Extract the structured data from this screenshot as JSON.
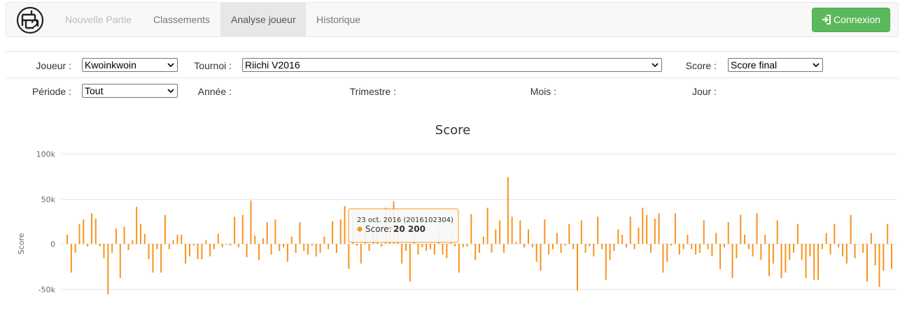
{
  "nav": {
    "items": [
      {
        "label": "Nouvelle Partie",
        "state": "disabled"
      },
      {
        "label": "Classements",
        "state": "normal"
      },
      {
        "label": "Analyse joueur",
        "state": "active"
      },
      {
        "label": "Historique",
        "state": "normal"
      }
    ],
    "login_label": "Connexion",
    "login_icon": "sign-in-icon",
    "brand_icon": "logo-icon"
  },
  "filters": {
    "joueur_label": "Joueur :",
    "joueur_value": "Kwoinkwoin",
    "tournoi_label": "Tournoi :",
    "tournoi_value": "Riichi V2016",
    "score_label": "Score :",
    "score_value": "Score final",
    "periode_label": "Période :",
    "periode_value": "Tout",
    "annee_label": "Année :",
    "trimestre_label": "Trimestre :",
    "mois_label": "Mois :",
    "jour_label": "Jour :"
  },
  "colors": {
    "bar": "#f7941d",
    "login": "#5cb85c",
    "grid": "#e6e6e6"
  },
  "chart_data": {
    "type": "bar",
    "title": "Score",
    "ylabel": "Score",
    "ylim": [
      -60000,
      100000
    ],
    "y_ticks": [
      {
        "value": 100000,
        "label": "100k"
      },
      {
        "value": 50000,
        "label": "50k"
      },
      {
        "value": 0,
        "label": "0"
      },
      {
        "value": -50000,
        "label": "-50k"
      }
    ],
    "grid": true,
    "series": [
      {
        "values": [
          10000,
          -32000,
          -10000,
          22000,
          27000,
          -3000,
          34000,
          28000,
          -3000,
          -16000,
          -56000,
          -10000,
          17000,
          -38000,
          19000,
          -7000,
          4000,
          41000,
          22000,
          11000,
          -17000,
          -32000,
          -6000,
          -32000,
          32000,
          -6000,
          4000,
          10000,
          10000,
          -22000,
          -14000,
          -2000,
          -17000,
          -17000,
          4000,
          -14000,
          -6000,
          11000,
          -4000,
          -1000,
          -2000,
          30000,
          -4000,
          32000,
          -15000,
          48000,
          9000,
          -18000,
          6000,
          24000,
          -12000,
          27000,
          -8000,
          -4000,
          -20000,
          8000,
          -10000,
          24000,
          -8000,
          -12000,
          -2000,
          -14000,
          -10000,
          8000,
          -6000,
          25000,
          -10000,
          27000,
          42000,
          -28000,
          34000,
          -2000,
          -22000,
          26000,
          -8000,
          23000,
          31000,
          -3000,
          40000,
          38000,
          47000,
          28000,
          -22000,
          -8000,
          -42000,
          26000,
          -12000,
          -4000,
          -8000,
          -6000,
          -12000,
          18000,
          -12000,
          -16000,
          10000,
          -3000,
          -32000,
          -4000,
          -3000,
          33000,
          -18000,
          -10000,
          8000,
          40000,
          -10000,
          16000,
          26000,
          -10000,
          74000,
          30000,
          2000,
          26000,
          -4000,
          16000,
          -4000,
          -20000,
          -30000,
          27000,
          -12000,
          -6000,
          12000,
          -10000,
          -2000,
          22000,
          -6000,
          -52000,
          26000,
          -10000,
          -3000,
          -14000,
          30000,
          -6000,
          -40000,
          -18000,
          -8000,
          16000,
          10000,
          -4000,
          30000,
          -6000,
          18000,
          40000,
          32000,
          -10000,
          28000,
          34000,
          -32000,
          -20000,
          -2000,
          34000,
          -12000,
          -6000,
          10000,
          -6000,
          -12000,
          -10000,
          26000,
          -6000,
          -14000,
          12000,
          -28000,
          -4000,
          24000,
          -38000,
          -16000,
          32000,
          10000,
          -6000,
          -14000,
          34000,
          -18000,
          10000,
          -36000,
          -22000,
          26000,
          -38000,
          -32000,
          -18000,
          -10000,
          22000,
          -18000,
          -38000,
          -14000,
          -40000,
          -40000,
          -6000,
          12000,
          -12000,
          22000,
          -4000,
          -14000,
          -22000,
          32000,
          -16000,
          0,
          -10000,
          -42000,
          12000,
          -24000,
          -48000,
          -30000,
          22000,
          -28000
        ],
        "color": "#f7941d"
      }
    ],
    "tooltip": {
      "date_line": "23 oct. 2016 (2016102304)",
      "series_label": "Score:",
      "value_text": "20 200"
    }
  }
}
